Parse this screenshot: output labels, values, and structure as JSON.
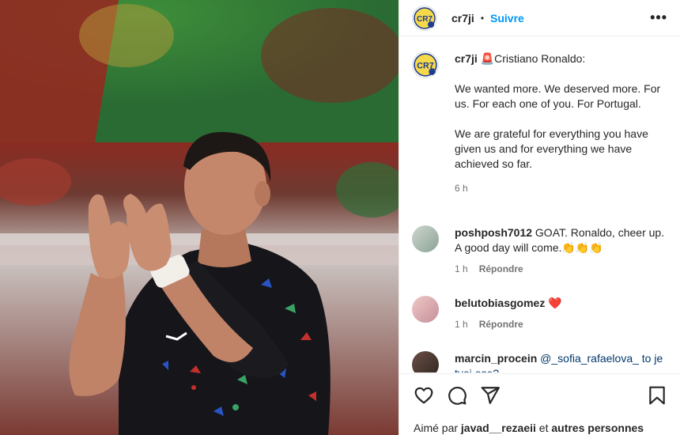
{
  "post_header": {
    "username": "cr7ji",
    "separator": "•",
    "follow_label": "Suivre",
    "more_icon": "more-horizontal-icon",
    "more_label": "•••"
  },
  "caption": {
    "username": "cr7ji",
    "prefix_emoji": "🚨",
    "lines": [
      "Cristiano Ronaldo:",
      "We wanted more. We deserved more. For us. For each one of you. For Portugal.",
      "We are grateful for everything you have given us and for everything we have achieved so far."
    ],
    "time": "6 h"
  },
  "comments": [
    {
      "username": "poshposh7012",
      "text": "GOAT. Ronaldo, cheer up. A good day will come.👏👏👏",
      "time": "1 h",
      "reply_label": "Répondre"
    },
    {
      "username": "belutobiasgomez",
      "text": "❤️",
      "time": "1 h",
      "reply_label": "Répondre"
    },
    {
      "username": "marcin_procein",
      "text": "@_sofia_rafaelova_ to je tvoj ose?"
    }
  ],
  "actions": {
    "like_icon": "heart-icon",
    "comment_icon": "comment-icon",
    "share_icon": "share-icon",
    "save_icon": "bookmark-icon"
  },
  "likes": {
    "prefix": "Aimé par",
    "user": "javad__rezaeii",
    "middle": "et",
    "others": "autres personnes"
  },
  "colors": {
    "accent": "#0095f6",
    "text": "#262626",
    "muted": "#737373",
    "divider": "#efefef",
    "jersey": "#15151a"
  }
}
